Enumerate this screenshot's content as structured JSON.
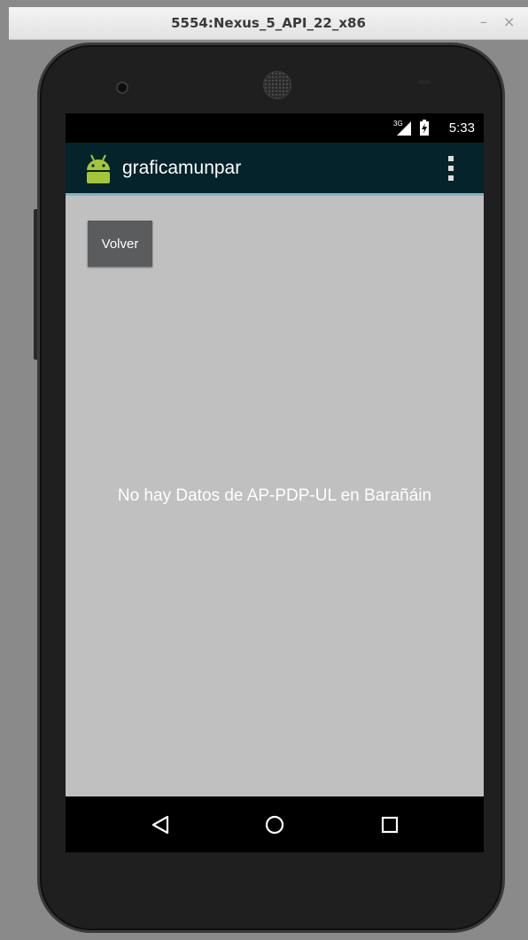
{
  "window": {
    "title": "5554:Nexus_5_API_22_x86",
    "minimize_label": "–",
    "close_label": "×"
  },
  "status_bar": {
    "network_label": "3G",
    "time": "5:33"
  },
  "app_bar": {
    "title": "graficamunpar",
    "icon": "android-robot-icon",
    "menu_icon": "overflow-menu-icon"
  },
  "content": {
    "back_button_label": "Volver",
    "empty_message": "No hay Datos de AP-PDP-UL en Barañáin"
  },
  "nav_bar": {
    "back_icon": "back-triangle-icon",
    "home_icon": "home-circle-icon",
    "recents_icon": "recents-square-icon"
  },
  "colors": {
    "app_bar": "#04232a",
    "app_bar_accent": "#7fb3c4",
    "content_bg": "#c0c0c0",
    "button_bg": "#5a5c5e",
    "android_green": "#a4c639"
  }
}
